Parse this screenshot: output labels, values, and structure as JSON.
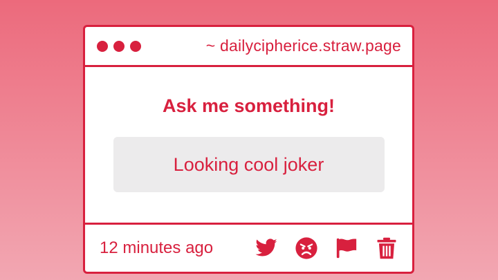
{
  "window": {
    "url_text": "~ dailycipherice.straw.page"
  },
  "main": {
    "heading": "Ask me something!",
    "answer_text": "Looking cool joker"
  },
  "footer": {
    "timestamp": "12 minutes ago",
    "actions": [
      "twitter-icon",
      "angry-face-icon",
      "flag-icon",
      "trash-icon"
    ]
  },
  "colors": {
    "accent": "#d8203e",
    "background_top": "#ec6a7c",
    "background_bottom": "#f2a7b2",
    "card": "#ffffff",
    "answer_box": "#ecebec"
  }
}
